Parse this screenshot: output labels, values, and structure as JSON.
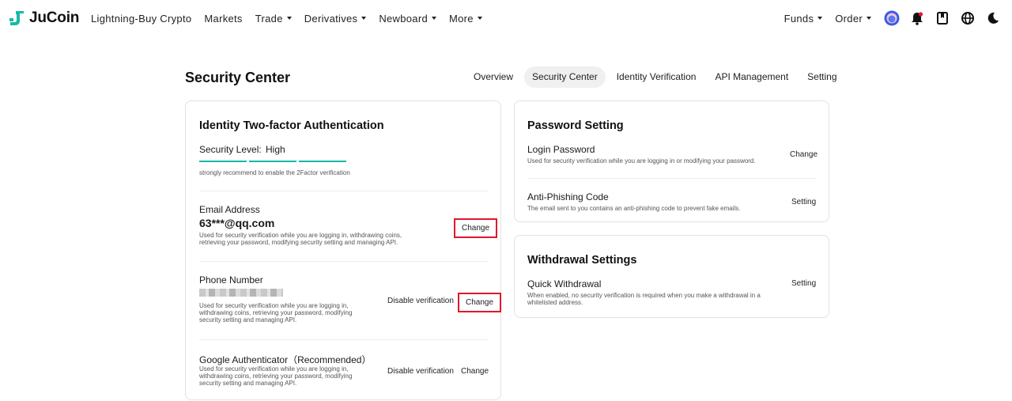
{
  "brand": {
    "name": "JuCoin"
  },
  "nav": {
    "left": [
      {
        "label": "Lightning-Buy Crypto",
        "dropdown": false
      },
      {
        "label": "Markets",
        "dropdown": false
      },
      {
        "label": "Trade",
        "dropdown": true
      },
      {
        "label": "Derivatives",
        "dropdown": true
      },
      {
        "label": "Newboard",
        "dropdown": true
      },
      {
        "label": "More",
        "dropdown": true
      }
    ],
    "right": [
      {
        "label": "Funds",
        "dropdown": true
      },
      {
        "label": "Order",
        "dropdown": true
      }
    ],
    "icons": [
      "avatar-icon",
      "notification-bell-icon",
      "bookmark-icon",
      "globe-icon",
      "dark-mode-moon-icon"
    ]
  },
  "page": {
    "title": "Security Center",
    "tabs": [
      "Overview",
      "Security Center",
      "Identity Verification",
      "API Management",
      "Setting"
    ],
    "active_tab": "Security Center"
  },
  "two_factor": {
    "title": "Identity Two-factor Authentication",
    "level_label": "Security Level:",
    "level_value": "High",
    "level_bars_filled": 3,
    "level_bars_total": 3,
    "recommend": "strongly recommend to enable the 2Factor verification",
    "email": {
      "label": "Email Address",
      "value": "63***@qq.com",
      "desc1": "Used for security verification while you are logging in, withdrawing coins,",
      "desc2": "retrieving your password, modifying security setting and managing API.",
      "change": "Change"
    },
    "phone": {
      "label": "Phone Number",
      "desc1": "Used for security verification while you are logging in,",
      "desc2": "withdrawing coins, retrieving your password, modifying",
      "desc3": "security setting and managing API.",
      "disable": "Disable verification",
      "change": "Change"
    },
    "google": {
      "label": "Google Authenticator（Recommended）",
      "desc1": "Used for security verification while you are logging in,",
      "desc2": "withdrawing coins, retrieving your password, modifying",
      "desc3": "security setting and managing API.",
      "disable": "Disable verification",
      "change": "Change"
    }
  },
  "password": {
    "title": "Password Setting",
    "login": {
      "label": "Login Password",
      "desc": "Used for security verification while you are logging in or modifying your password.",
      "action": "Change"
    },
    "anti_phishing": {
      "label": "Anti-Phishing Code",
      "desc": "The email sent to you contains an anti-phishing code to prevent fake emails.",
      "action": "Setting"
    }
  },
  "withdrawal": {
    "title": "Withdrawal Settings",
    "quick": {
      "label": "Quick Withdrawal",
      "desc1": "When enabled, no security verification is required when you make a withdrawal in a",
      "desc2": "whitelisted address.",
      "action": "Setting"
    }
  },
  "colors": {
    "accent": "#17b9a6",
    "highlight_border": "#e0182d",
    "logo": "#17b9a6"
  }
}
